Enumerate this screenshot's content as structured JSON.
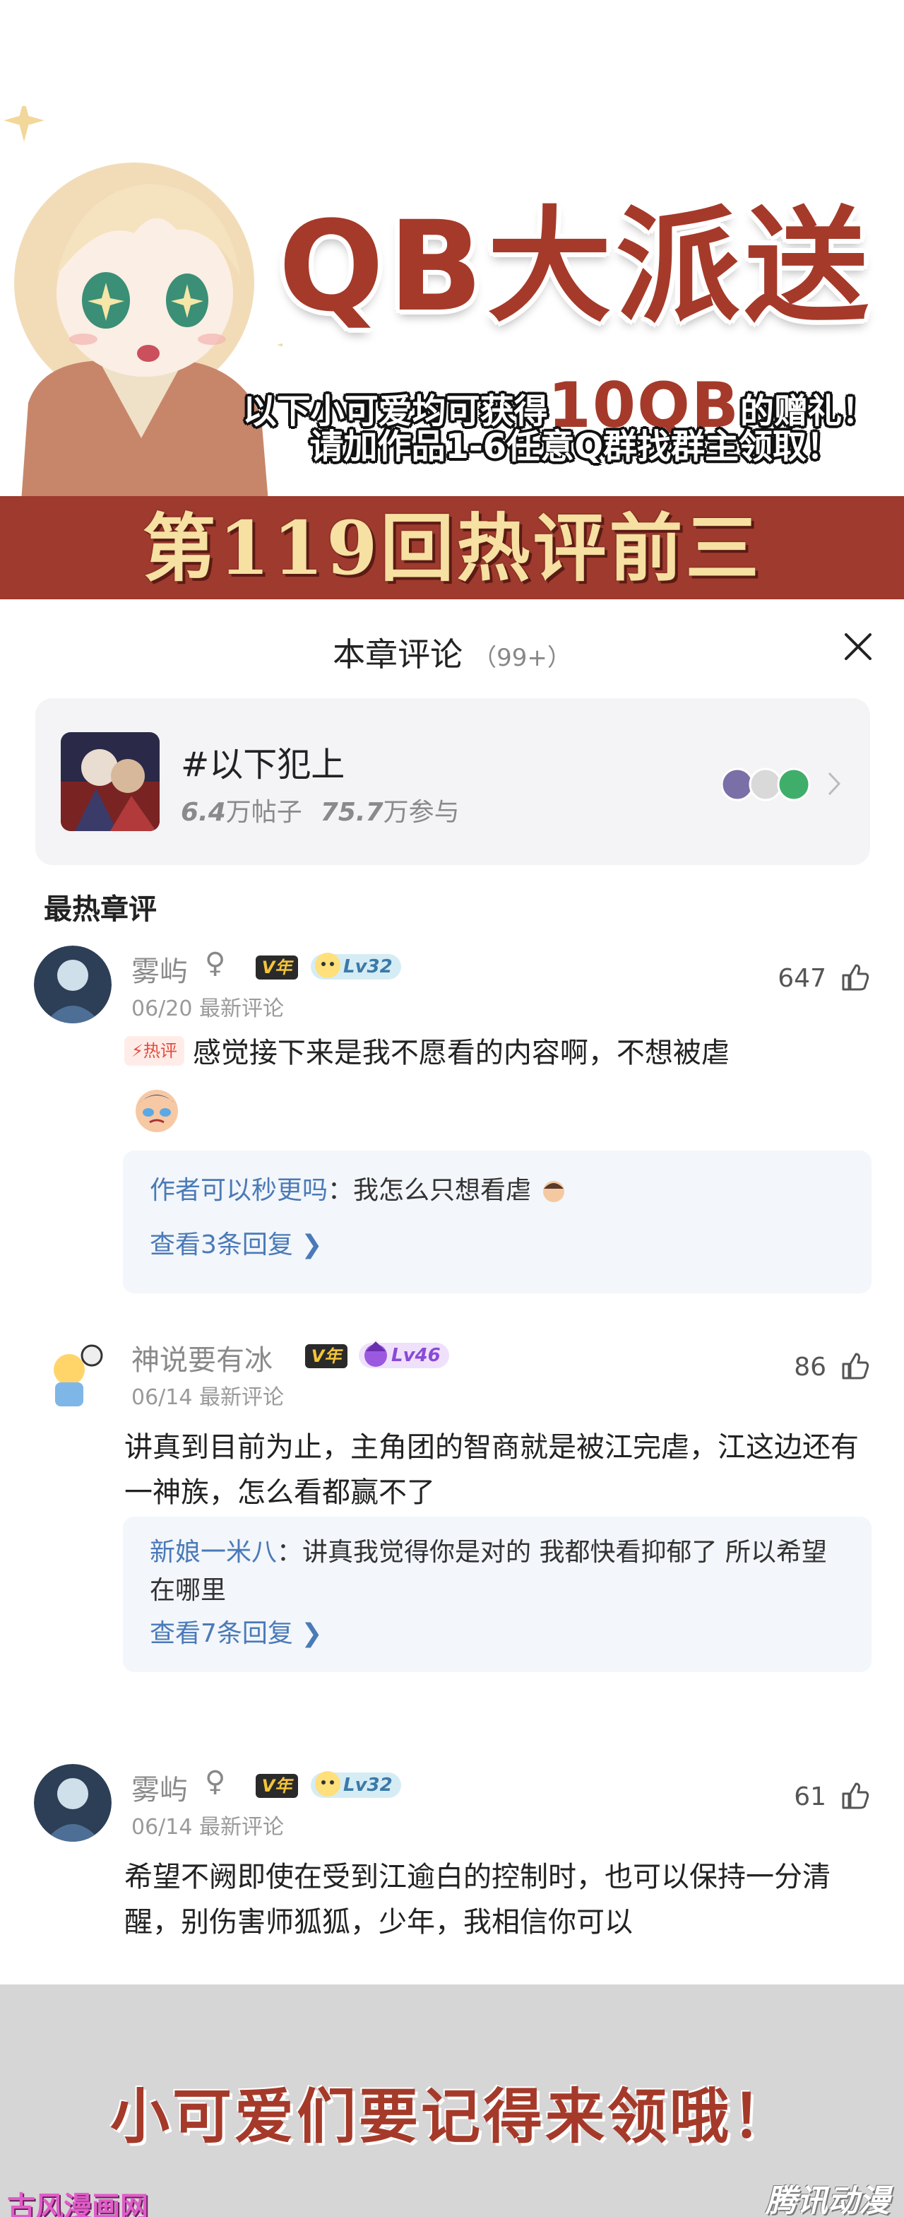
{
  "banner": {
    "title": "QB大派送",
    "line1_pre": "以下小可爱均可获得",
    "line1_highlight": "10QB",
    "line1_post": "的赠礼！",
    "line2": "请加作品1-6任意Q群找群主领取！",
    "chapter_banner": "第119回热评前三",
    "colors": {
      "brand_red": "#a53a2a",
      "band_red": "#9e3a2e",
      "band_text": "#f6e0a2"
    }
  },
  "panel": {
    "title": "本章评论",
    "count": "（99+）",
    "close_icon": "close-icon"
  },
  "topic": {
    "name": "#以下犯上",
    "posts_value": "6.4",
    "posts_unit": "万帖子",
    "participants_value": "75.7",
    "participants_unit": "万参与"
  },
  "section_title": "最热章评",
  "comments": [
    {
      "username": "雾屿",
      "gender": "♀",
      "vip": "V年",
      "level": "Lv32",
      "date": "06/20 最新评论",
      "likes": "647",
      "hot_tag": "⚡热评",
      "text": "感觉接下来是我不愿看的内容啊，不想被虐",
      "reply_name": "作者可以秒更吗",
      "reply_sep": "：",
      "reply_text": "我怎么只想看虐",
      "reply_more": "查看3条回复 ❯"
    },
    {
      "username": "神说要有冰",
      "vip": "V年",
      "level": "Lv46",
      "date": "06/14 最新评论",
      "likes": "86",
      "text": "讲真到目前为止，主角团的智商就是被江完虐，江这边还有一神族，怎么看都赢不了",
      "reply_name": "新娘一米八",
      "reply_sep": "：",
      "reply_text": "讲真我觉得你是对的 我都快看抑郁了 所以希望在哪里",
      "reply_more": "查看7条回复 ❯"
    },
    {
      "username": "雾屿",
      "gender": "♀",
      "vip": "V年",
      "level": "Lv32",
      "date": "06/14 最新评论",
      "likes": "61",
      "text": "希望不阙即使在受到江逾白的控制时，也可以保持一分清醒，别伤害师狐狐，少年，我相信你可以"
    }
  ],
  "footer": {
    "text": "小可爱们要记得来领哦！",
    "watermark_left": "古风漫画网",
    "watermark_right": "腾讯动漫"
  }
}
